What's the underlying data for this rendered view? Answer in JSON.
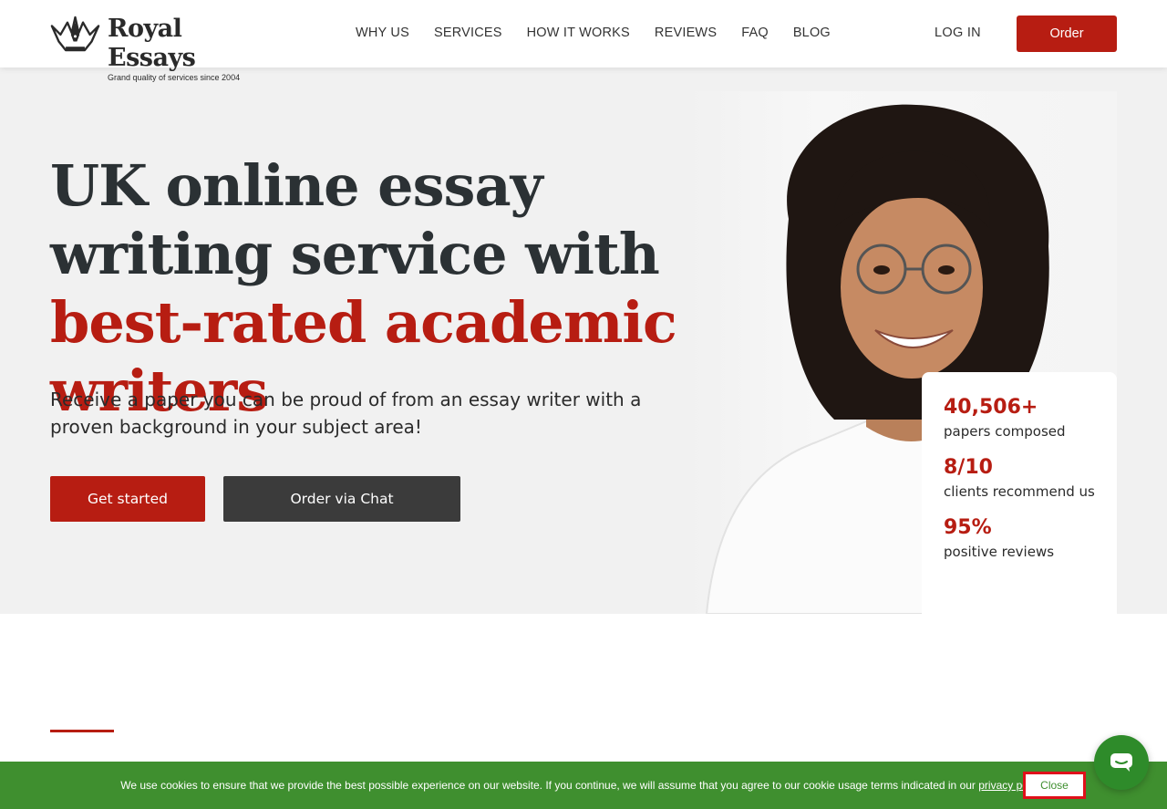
{
  "brand": {
    "name": "Royal Essays",
    "tagline": "Grand quality of services since 2004"
  },
  "nav": {
    "items": [
      {
        "label": "WHY US"
      },
      {
        "label": "SERVICES"
      },
      {
        "label": "HOW IT WORKS"
      },
      {
        "label": "REVIEWS"
      },
      {
        "label": "FAQ"
      },
      {
        "label": "BLOG"
      }
    ],
    "login_label": "LOG IN",
    "order_label": "Order"
  },
  "hero": {
    "headline_part1": "UK online essay writing service with ",
    "headline_accent": "best-rated academic writers",
    "subtitle": "Receive a paper you can be proud of from an essay writer with a proven background in your subject area!",
    "primary_cta": "Get started",
    "secondary_cta": "Order via Chat"
  },
  "stats": [
    {
      "value": "40,506+",
      "label": "papers composed"
    },
    {
      "value": "8/10",
      "label": "clients recommend us"
    },
    {
      "value": "95%",
      "label": "positive reviews"
    }
  ],
  "cookie": {
    "text": "We use cookies to ensure that we provide the best possible experience on our website. If you continue, we will assume that you agree to our cookie usage terms indicated in our ",
    "link": "privacy policy",
    "end": ".",
    "close_label": "Close"
  },
  "colors": {
    "accent": "#b71d12",
    "dark_button": "#3b3b3b",
    "cookie_bar": "#3f8f2f"
  },
  "icons": {
    "logo": "crown-pen-icon",
    "chat": "chat-icon"
  }
}
